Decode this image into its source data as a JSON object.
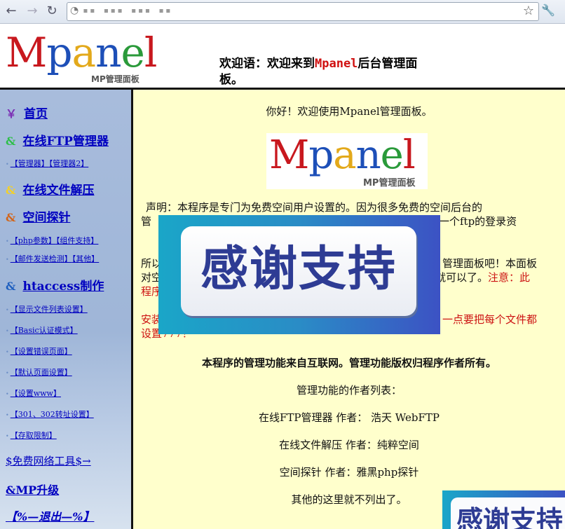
{
  "browser": {
    "back_icon": "←",
    "forward_icon": "→",
    "reload_icon": "↻",
    "url_icon": "◔",
    "url_text": "▪▪ ▪▪▪  ▪▪▪ ▪▪",
    "bookmark_icon": "☆",
    "settings_icon": "🔧"
  },
  "header": {
    "logo": {
      "letters": [
        "M",
        "p",
        "a",
        "n",
        "e",
        "l"
      ],
      "sub": "MP管理面板"
    },
    "welcome_prefix": "欢迎语：欢迎来到",
    "welcome_brand": "Mpanel",
    "welcome_suffix": "后台管理面板。"
  },
  "sidebar": {
    "home": {
      "symbol": "￥",
      "label": "首页"
    },
    "ftp": {
      "symbol": "&",
      "label": "在线FTP管理器"
    },
    "ftp_links": [
      "【管理器】",
      "【管理器2】"
    ],
    "unzip": {
      "symbol": "&",
      "label": "在线文件解压"
    },
    "probe": {
      "symbol": "&",
      "label": "空间探针"
    },
    "probe_links_1": [
      "【php参数】",
      "【组件支持】"
    ],
    "probe_links_2": [
      "【邮件发送检测】",
      "【其他】"
    ],
    "htaccess": {
      "symbol": "&",
      "label": "htaccess制作"
    },
    "ht_links": [
      "【显示文件列表设置】",
      "【Basic认证模式】",
      "【设置错误页面】",
      "【默认页面设置】",
      "【设置www】",
      "【301、302转址设置】",
      "【存取限制】"
    ],
    "free_tools": "$免费网络工具$→",
    "upgrade": "&MP升级",
    "logout": "【%—退出—%】"
  },
  "main": {
    "greeting": "你好！欢迎使用Mpanel管理面板。",
    "logo": {
      "letters": [
        "M",
        "p",
        "a",
        "n",
        "e",
        "l"
      ],
      "sub": "MP管理面板"
    },
    "statement_1": "声明：本程序是专门为免费空间用户设置的。因为很多免费的空间后台的",
    "statement_2_left": "管",
    "statement_2_right": "只有一个ftp的登录资",
    "para_3_left": "所以",
    "para_3_right": "管理面板吧！本面板",
    "para_4_left": "对空",
    "para_4_right": "就可以了。",
    "para_4_note": "注意：此",
    "para_5_left": "程序",
    "para_6_left": "安装",
    "para_6_right": "一点要把每个文件都",
    "para_7": "设置777！",
    "copyright": "本程序的管理功能来自互联网。管理功能版权归程序作者所有。",
    "authors_title": "管理功能的作者列表：",
    "author_1": "在线FTP管理器  作者：  浩天 WebFTP",
    "author_2": "在线文件解压  作者：纯粹空间",
    "author_3": "空间探针  作者：雅黑php探针",
    "others": "其他的这里就不列出了。"
  },
  "ads": {
    "main_text": "感谢支持",
    "corner_text": "感谢支持"
  },
  "colors": {
    "sidebar_link": "#0000c0",
    "main_bg": "#ffffcc",
    "warning_red": "#cc1111",
    "ad_text": "#2e3c94"
  }
}
